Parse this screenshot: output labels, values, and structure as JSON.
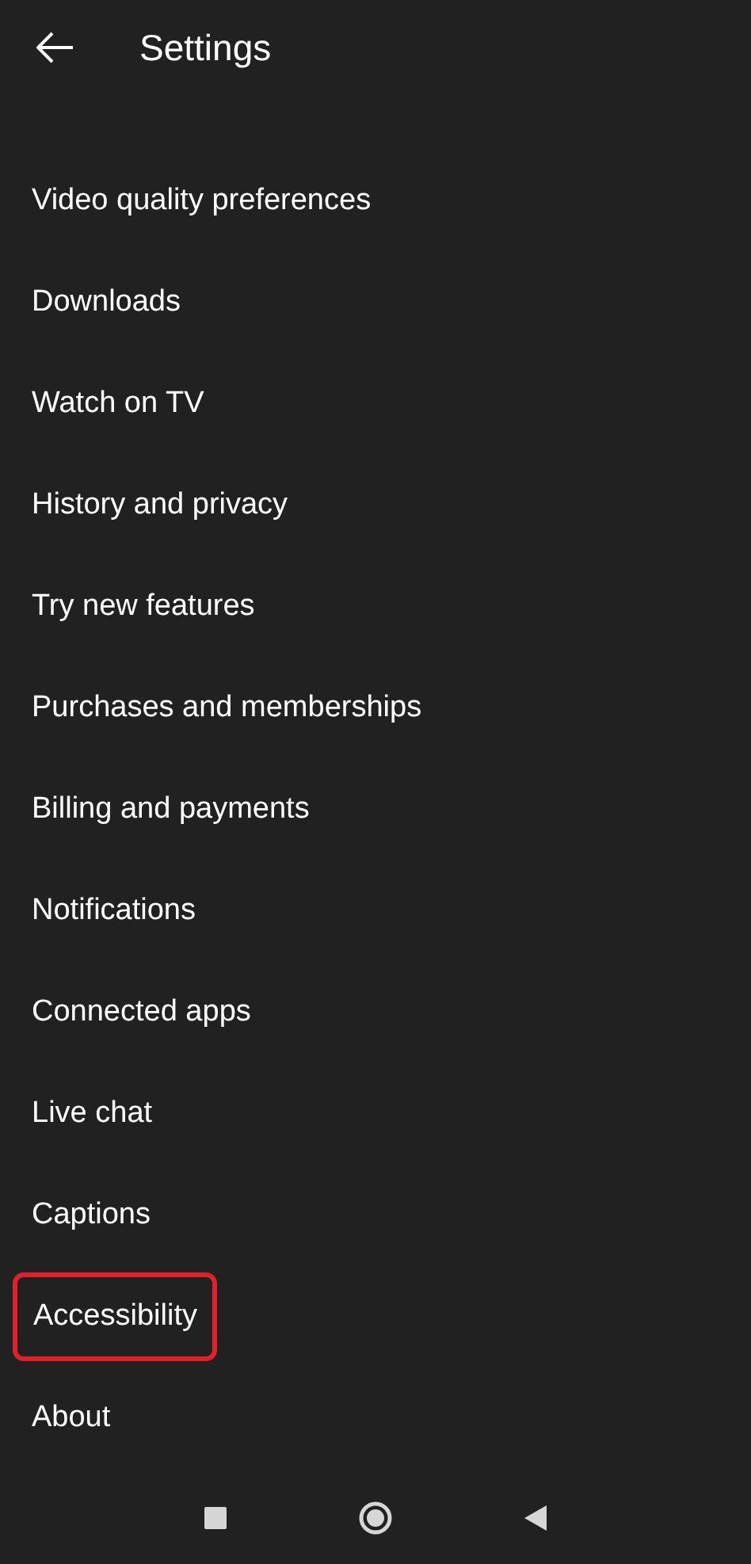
{
  "header": {
    "title": "Settings"
  },
  "items": [
    {
      "label": "Video quality preferences",
      "highlighted": false
    },
    {
      "label": "Downloads",
      "highlighted": false
    },
    {
      "label": "Watch on TV",
      "highlighted": false
    },
    {
      "label": "History and privacy",
      "highlighted": false
    },
    {
      "label": "Try new features",
      "highlighted": false
    },
    {
      "label": "Purchases and memberships",
      "highlighted": false
    },
    {
      "label": "Billing and payments",
      "highlighted": false
    },
    {
      "label": "Notifications",
      "highlighted": false
    },
    {
      "label": "Connected apps",
      "highlighted": false
    },
    {
      "label": "Live chat",
      "highlighted": false
    },
    {
      "label": "Captions",
      "highlighted": false
    },
    {
      "label": "Accessibility",
      "highlighted": true
    },
    {
      "label": "About",
      "highlighted": false
    }
  ]
}
